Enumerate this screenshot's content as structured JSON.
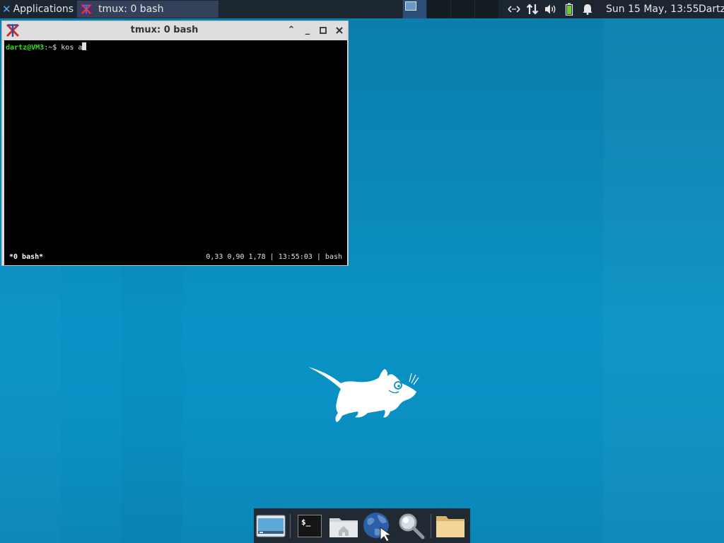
{
  "panel": {
    "applications_label": "Applications",
    "separator_glyph": "≡",
    "task_title": "tmux: 0 bash",
    "clock": "Sun 15 May, 13:55",
    "user": "Dartz",
    "tray_icons": [
      "network-arrows-icon",
      "network-updown-icon",
      "volume-icon",
      "battery-icon",
      "notification-bell-icon"
    ]
  },
  "window": {
    "title": "tmux: 0 bash",
    "prompt_user": "dartz@VM3",
    "prompt_path": ":~$ ",
    "command_text": "kos a",
    "status_left": "*0 bash*",
    "status_right": "0,33 0,90 1,78 | 13:55:03 | bash"
  },
  "dock": {
    "items": [
      "show-desktop",
      "terminal",
      "home-folder",
      "web-browser",
      "app-finder",
      "file-manager"
    ],
    "terminal_glyph": "$_"
  },
  "colors": {
    "panel_bg": "#1c2631",
    "desktop_bg": "#0a8fc2",
    "prompt_green": "#37e21c",
    "dock_bg": "#212a32"
  }
}
